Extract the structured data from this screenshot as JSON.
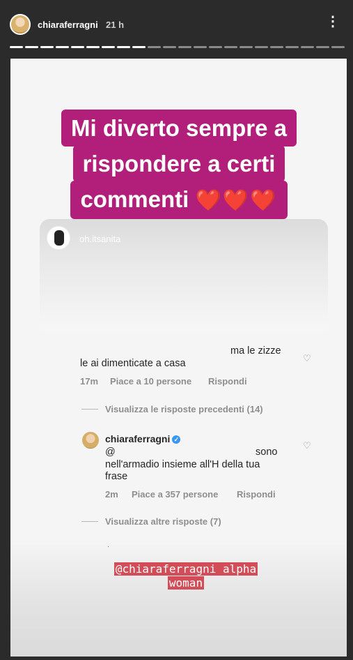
{
  "header": {
    "username": "chiaraferragni",
    "time": "21 h",
    "more_icon": "⋮⋮",
    "progress_total": 22,
    "progress_done": 9
  },
  "banner": {
    "lines": [
      "Mi diverto sempre a",
      "rispondere a certi",
      "commenti"
    ],
    "hearts": "❤️❤️❤️"
  },
  "card": {
    "username": "oh.itsanita"
  },
  "comment": {
    "line_right": "ma le zizze",
    "line_left": "le ai dimenticate a casa",
    "age": "17m",
    "likes": "Piace a 10 persone",
    "reply": "Rispondi"
  },
  "view_previous": "Visualizza le risposte precedenti (14)",
  "reply": {
    "username": "chiaraferragni",
    "verified_icon": "✓",
    "at": "@",
    "sono": "sono",
    "line2": "nell'armadio insieme all'H della tua",
    "line3": "frase",
    "age": "2m",
    "likes": "Piace a 357 persone",
    "reply": "Rispondi"
  },
  "view_more": "Visualizza altre risposte (7)",
  "mention": {
    "line1": "@chiaraferragni alpha",
    "line2": "woman"
  },
  "colors": {
    "banner_bg": "#b21f7a",
    "mention_bg": "#d24d57",
    "verified": "#3897f0"
  }
}
